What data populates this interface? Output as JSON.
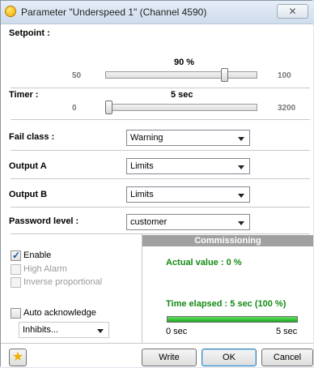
{
  "window": {
    "title": "Parameter \"Underspeed 1\" (Channel 4590)",
    "close_glyph": "✕"
  },
  "setpoint": {
    "label": "Setpoint :",
    "value": "90 %",
    "min": "50",
    "max": "100",
    "level_fraction": 0.8
  },
  "timer": {
    "label": "Timer :",
    "value": "5 sec",
    "min": "0",
    "max": "3200",
    "level_fraction": 0.0016
  },
  "dropdowns": [
    {
      "label": "Fail class :",
      "value": "Warning"
    },
    {
      "label": "Output A",
      "value": "Limits"
    },
    {
      "label": "Output B",
      "value": "Limits"
    },
    {
      "label": "Password level :",
      "value": "customer"
    }
  ],
  "options": {
    "enable": {
      "label": "Enable",
      "checked": true
    },
    "high_alarm": {
      "label": "High Alarm",
      "checked": false
    },
    "inverse": {
      "label": "Inverse proportional",
      "checked": false
    },
    "auto_ack": {
      "label": "Auto acknowledge",
      "checked": false
    },
    "inhibits": {
      "value": "Inhibits..."
    }
  },
  "commissioning": {
    "header": "Commissioning",
    "actual_value": "Actual value : 0 %",
    "time_elapsed": "Time elapsed : 5 sec (100 %)",
    "progress_fraction": 1.0,
    "start": "0 sec",
    "end": "5 sec"
  },
  "buttons": {
    "write": "Write",
    "ok": "OK",
    "cancel": "Cancel"
  },
  "colors": {
    "accent_green": "#138a13",
    "progress_fill": "#2fbf2f",
    "commissioning_header": "#a0a0a0"
  },
  "icons": {
    "title": "parameter-icon",
    "favorite": "star-icon"
  }
}
